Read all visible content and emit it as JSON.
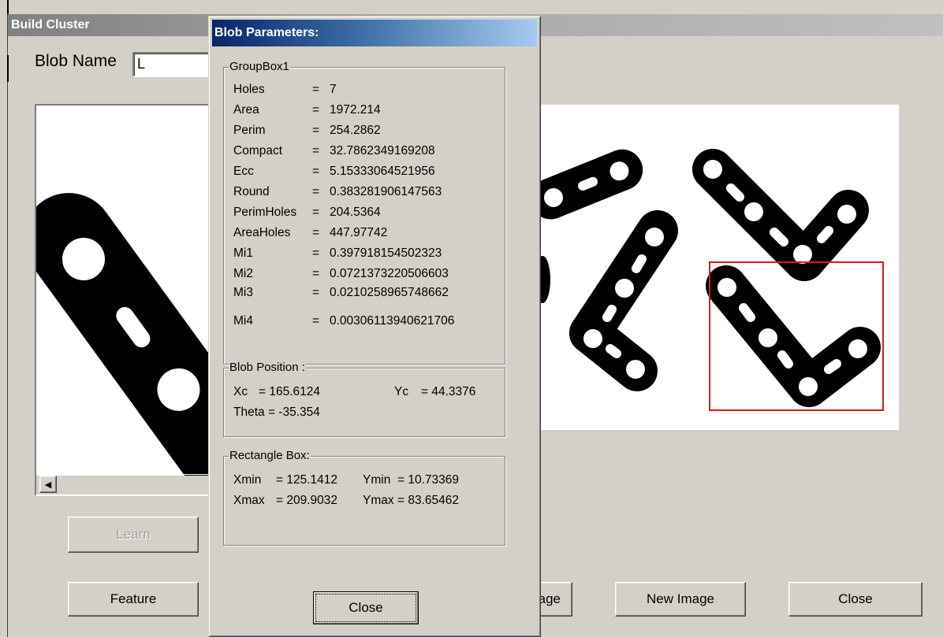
{
  "main_window": {
    "title": "Build Cluster",
    "blob_name_label": "Blob Name",
    "blob_name_value": "L",
    "buttons": {
      "learn": "Learn",
      "feature": "Feature",
      "partial_image_button": "age",
      "new_image": "New Image",
      "close": "Close"
    }
  },
  "dialog": {
    "title": "Blob Parameters:",
    "groupbox1": {
      "title": "GroupBox1",
      "rows": [
        {
          "name": "Holes",
          "value": "7"
        },
        {
          "name": "Area",
          "value": "1972.214"
        },
        {
          "name": "Perim",
          "value": "254.2862"
        },
        {
          "name": "Compact",
          "value": "32.7862349169208"
        },
        {
          "name": "Ecc",
          "value": "5.15333064521956"
        },
        {
          "name": "Round",
          "value": "0.383281906147563"
        },
        {
          "name": "PerimHoles",
          "value": "204.5364"
        },
        {
          "name": "AreaHoles",
          "value": "447.97742"
        },
        {
          "name": "Mi1",
          "value": "0.397918154502323"
        },
        {
          "name": "Mi2",
          "value": "0.0721373220506603"
        },
        {
          "name": "Mi3",
          "value": "0.0210258965748662"
        },
        {
          "name": "Mi4",
          "value": "0.00306113940621706"
        }
      ]
    },
    "blob_position": {
      "title": "Blob Position :",
      "xc_label": "Xc",
      "xc_value": "= 165.6124",
      "yc_label": "Yc",
      "yc_value": "= 44.3376",
      "theta_text": "Theta = -35.354"
    },
    "rectangle_box": {
      "title": "Rectangle Box:",
      "xmin_label": "Xmin",
      "xmin_value": "=  125.1412",
      "ymin_label": "Ymin",
      "ymin_value": "=  10.73369",
      "xmax_label": "Xmax",
      "xmax_value": "=  209.9032",
      "ymax_label": "Ymax",
      "ymax_value": "=  83.65462"
    },
    "close_button": "Close"
  },
  "colors": {
    "selection_box": "#e8141c",
    "dialog_title_start": "#0a246a",
    "dialog_title_end": "#a6caf0"
  }
}
